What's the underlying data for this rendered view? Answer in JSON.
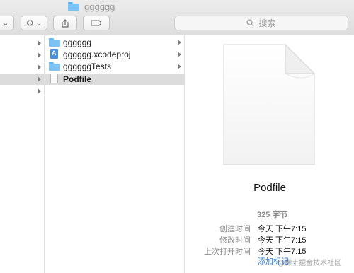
{
  "window": {
    "title": "gggggg"
  },
  "toolbar": {
    "search_placeholder": "搜索"
  },
  "files": [
    {
      "name": "gggggg",
      "icon": "folder-icon",
      "has_children": true,
      "selected": false
    },
    {
      "name": "gggggg.xcodeproj",
      "icon": "xcodeproj-icon",
      "has_children": true,
      "selected": false
    },
    {
      "name": "ggggggTests",
      "icon": "folder-icon",
      "has_children": true,
      "selected": false
    },
    {
      "name": "Podfile",
      "icon": "document-icon",
      "has_children": false,
      "selected": true
    }
  ],
  "preview": {
    "file_name": "Podfile",
    "size": "325 字节",
    "meta": [
      {
        "label": "创建时间",
        "value": "今天 下午7:15"
      },
      {
        "label": "修改时间",
        "value": "今天 下午7:15"
      },
      {
        "label": "上次打开时间",
        "value": "今天 下午7:15"
      }
    ],
    "add_tags": "添加标记..."
  },
  "watermark": "@稀土掘金技术社区",
  "colors": {
    "selection": "#dcdcdc",
    "folder": "#7cc2f5",
    "link": "#2d7cd6"
  }
}
